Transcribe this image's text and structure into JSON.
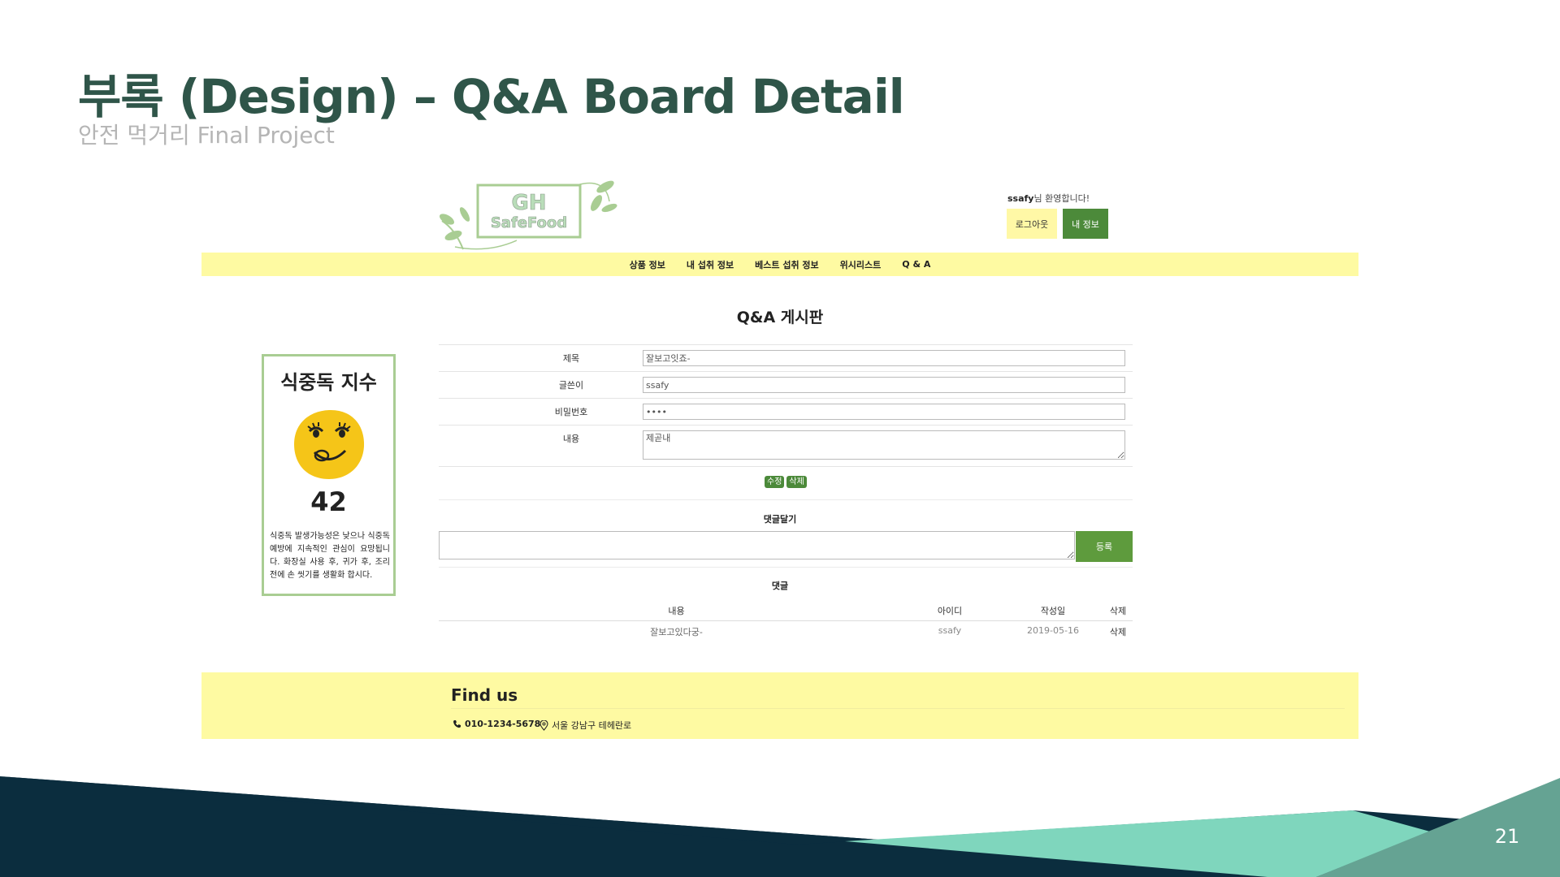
{
  "slide": {
    "title": "부록 (Design) – Q&A Board Detail",
    "subtitle": "안전 먹거리 Final Project",
    "page_number": "21"
  },
  "site": {
    "logo": {
      "line1": "GH",
      "line2": "SafeFood"
    },
    "header": {
      "welcome_user": "ssafy",
      "welcome_suffix": "님 환영합니다!",
      "logout_label": "로그아웃",
      "myinfo_label": "내 정보"
    },
    "nav": {
      "items": [
        {
          "label": "상품 정보"
        },
        {
          "label": "내 섭취 정보"
        },
        {
          "label": "베스트 섭취 정보"
        },
        {
          "label": "위시리스트"
        },
        {
          "label": "Q & A"
        }
      ]
    },
    "board": {
      "title": "Q&A 게시판",
      "fields": {
        "title_label": "제목",
        "title_value": "잘보고잇죠-",
        "author_label": "글쓴이",
        "author_value": "ssafy",
        "password_label": "비밀번호",
        "password_value": "••••",
        "content_label": "내용",
        "content_value": "제곧내"
      },
      "edit_label": "수정",
      "delete_label": "삭제"
    },
    "comment_write": {
      "label": "댓글달기",
      "register_label": "등록"
    },
    "comments": {
      "label": "댓글",
      "headers": {
        "content": "내용",
        "id": "아이디",
        "date": "작성일",
        "delete": "삭제"
      },
      "rows": [
        {
          "content": "잘보고있다궁-",
          "id": "ssafy",
          "date": "2019-05-16",
          "delete": "삭제"
        }
      ]
    },
    "side_card": {
      "title": "식중독 지수",
      "score": "42",
      "description": "식중독 발생가능성은 낮으나 식중독예방에 지속적인 관심이 요망됩니다. 화장실 사용 후, 귀가 후, 조리 전에 손 씻기를 생활화 합시다.",
      "face_color": "#f5c518"
    },
    "footer": {
      "title": "Find us",
      "phone": "010-1234-5678",
      "address": "서울 강남구 테헤란로"
    }
  },
  "colors": {
    "title": "#2f5549",
    "nav_bg": "#fefaa2",
    "button_green": "#4c8a3a",
    "card_border": "#a9cd93",
    "deco_navy": "#0b2d3e",
    "deco_mint": "#7fd6bd",
    "deco_teal": "#65a393"
  },
  "icons": {
    "phone": "phone-icon",
    "location": "location-pin-icon"
  }
}
